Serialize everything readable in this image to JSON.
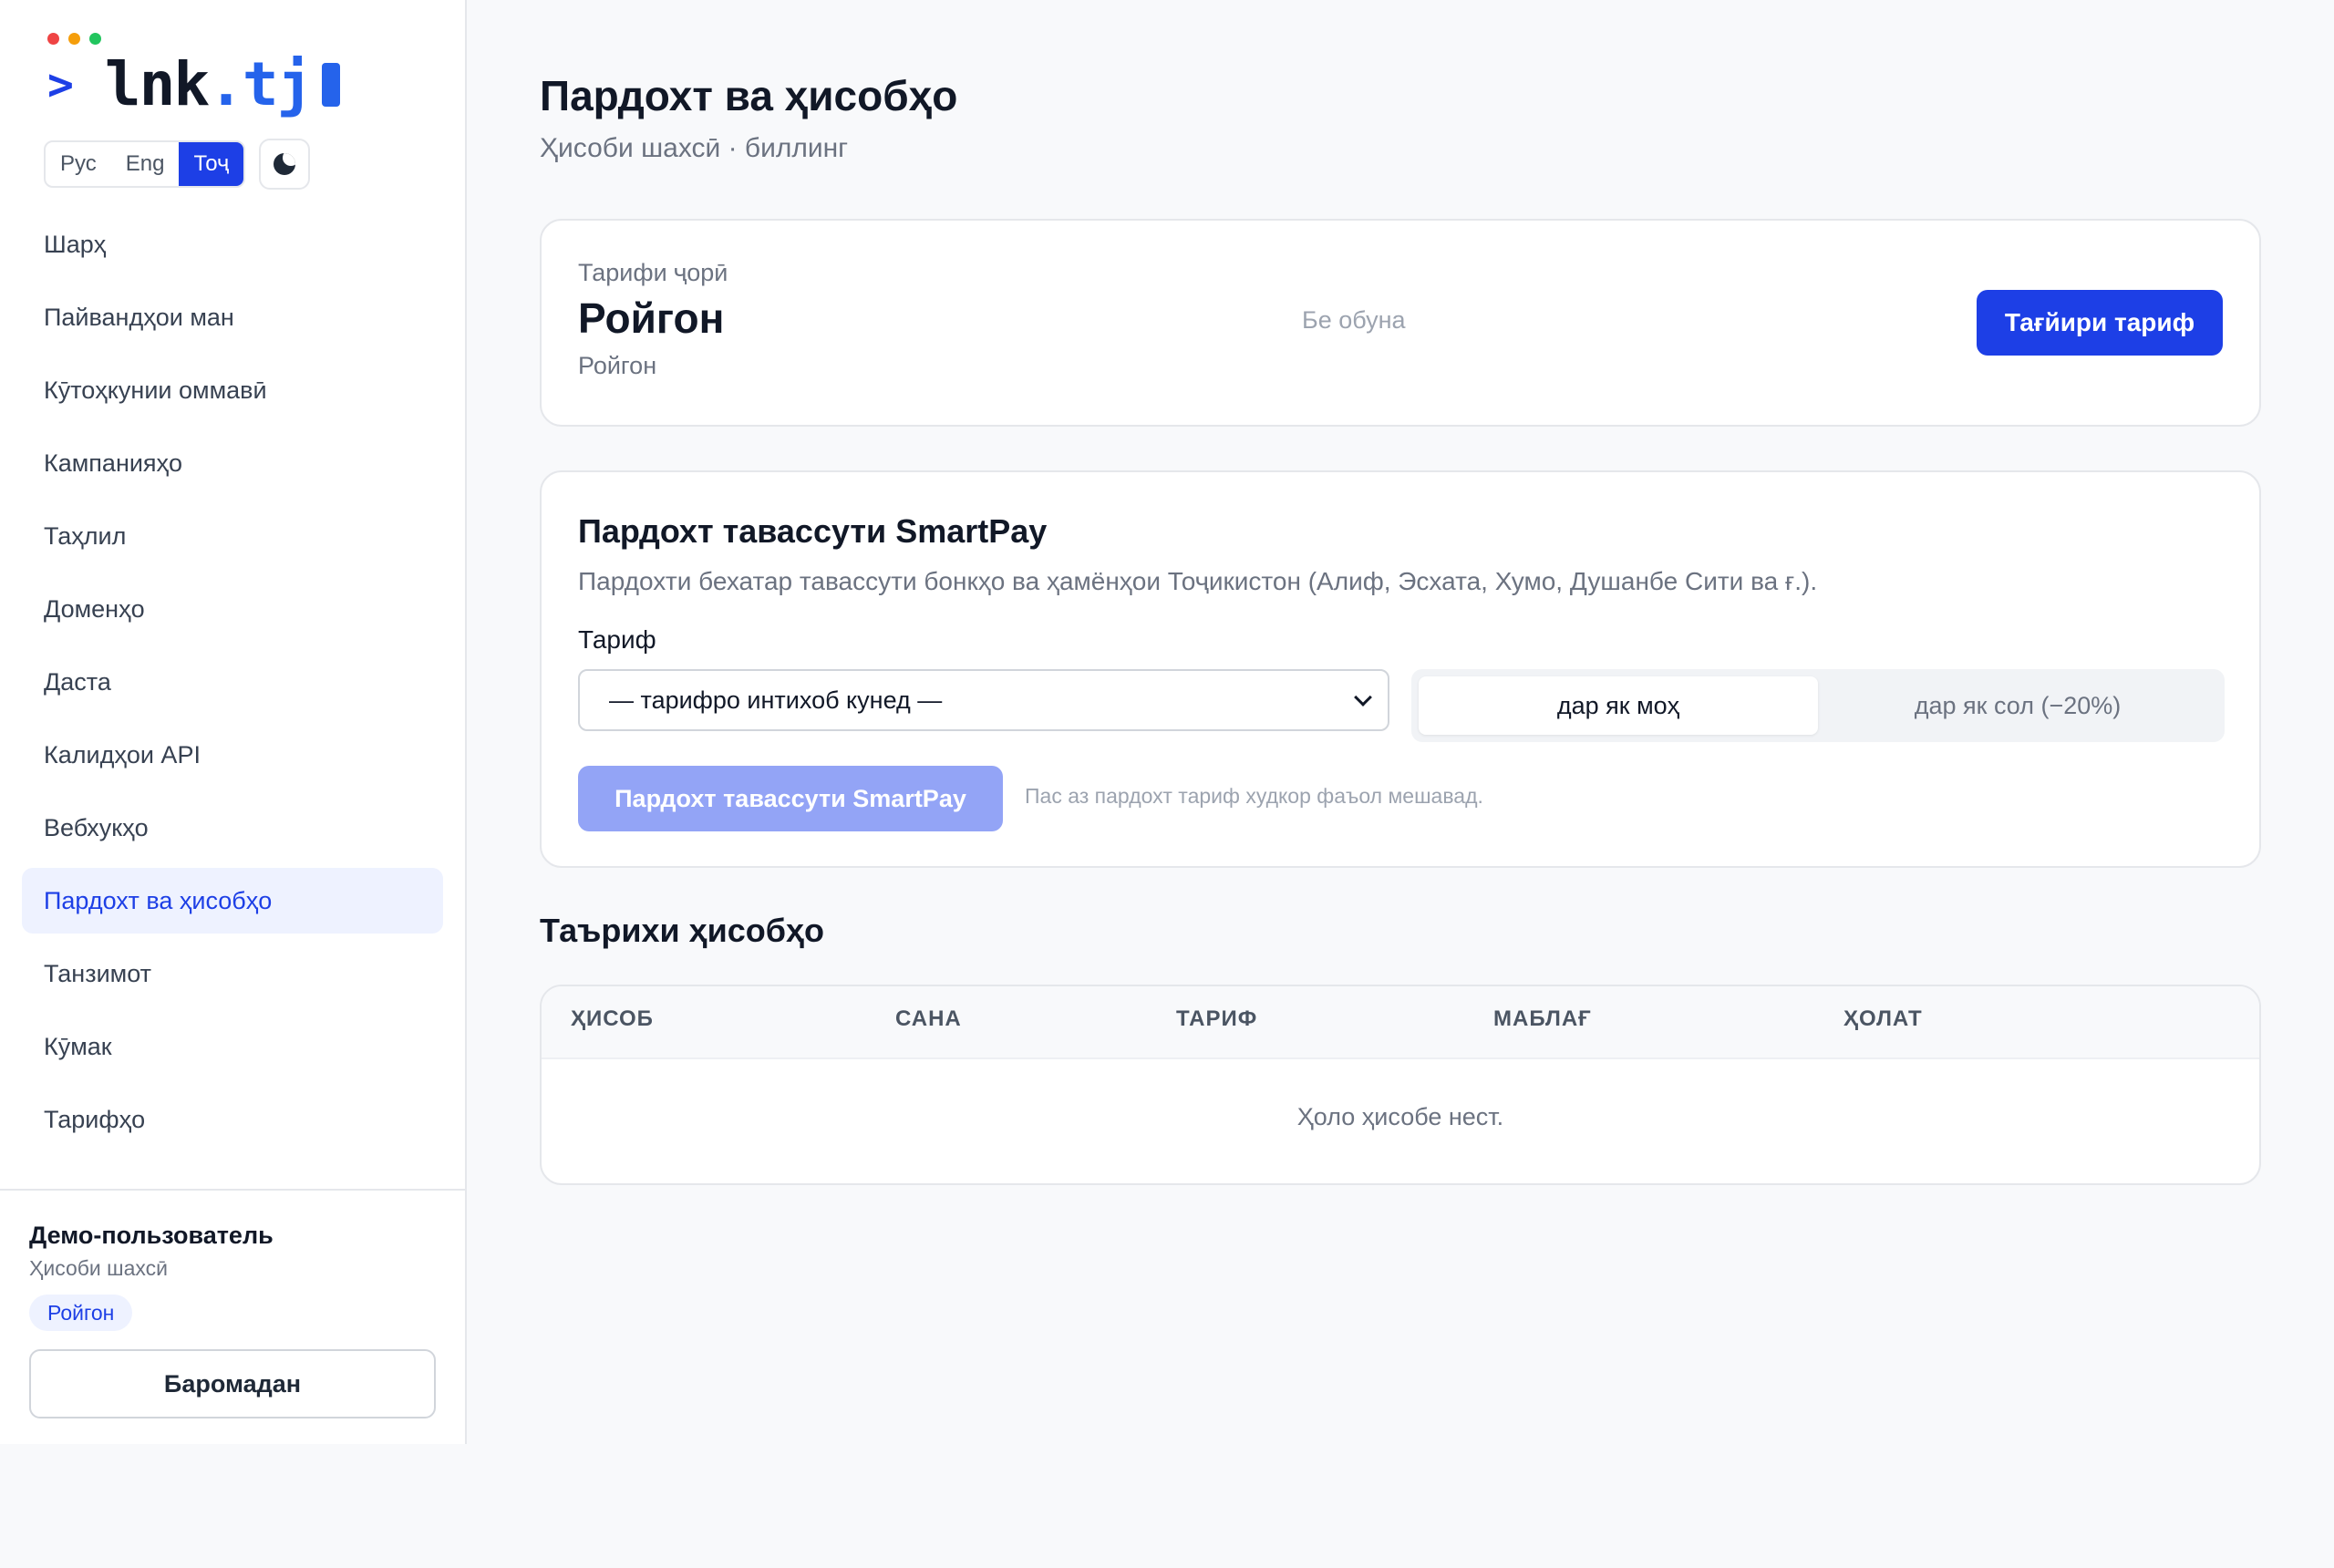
{
  "app": {
    "logo_prompt": ">",
    "logo_name": "lnk",
    "logo_tld": ".tj",
    "window_dots": [
      "#ef4444",
      "#f59e0b",
      "#22c55e"
    ]
  },
  "languages": [
    {
      "label": "Рус",
      "active": false
    },
    {
      "label": "Eng",
      "active": false
    },
    {
      "label": "Тоҷ",
      "active": true
    }
  ],
  "theme_toggle_icon": "moon-icon",
  "nav": [
    {
      "label": "Шарҳ",
      "active": false
    },
    {
      "label": "Пайвандҳои ман",
      "active": false
    },
    {
      "label": "Кӯтоҳкунии оммавӣ",
      "active": false
    },
    {
      "label": "Кампанияҳо",
      "active": false
    },
    {
      "label": "Таҳлил",
      "active": false
    },
    {
      "label": "Доменҳо",
      "active": false
    },
    {
      "label": "Даста",
      "active": false
    },
    {
      "label": "Калидҳои API",
      "active": false
    },
    {
      "label": "Вебхукҳо",
      "active": false
    },
    {
      "label": "Пардохт ва ҳисобҳо",
      "active": true
    },
    {
      "label": "Танзимот",
      "active": false
    },
    {
      "label": "Кӯмак",
      "active": false
    },
    {
      "label": "Тарифҳо",
      "active": false
    }
  ],
  "user": {
    "name": "Демо-пользователь",
    "account": "Ҳисоби шахсӣ",
    "plan": "Ройгон",
    "logout": "Баромадан"
  },
  "page": {
    "title": "Пардохт ва ҳисобҳо",
    "subtitle": "Ҳисоби шахсӣ · биллинг"
  },
  "current_plan": {
    "label": "Тарифи ҷорӣ",
    "name": "Ройгон",
    "sub": "Ройгон",
    "status": "Бе обуна",
    "change_button": "Тағйири тариф"
  },
  "smartpay": {
    "title": "Пардохт тавассути SmartPay",
    "description": "Пардохти бехатар тавассути бонкҳо ва ҳамёнҳои Тоҷикистон (Алиф, Эсхата, Хумо, Душанбе Сити ва ғ.).",
    "field_label": "Тариф",
    "select_value": "— тарифро интихоб кунед —",
    "period_options": [
      {
        "label": "дар як моҳ",
        "active": true
      },
      {
        "label": "дар як сол (−20%)",
        "active": false
      }
    ],
    "pay_button": "Пардохт тавассути SmartPay",
    "hint": "Пас аз пардохт тариф худкор фаъол мешавад."
  },
  "history": {
    "title": "Таърихи ҳисобҳо",
    "columns": [
      "ҲИСОБ",
      "САНА",
      "ТАРИФ",
      "МАБЛАҒ",
      "ҲОЛАТ"
    ],
    "rows": [],
    "empty": "Ҳоло ҳисобе нест."
  },
  "colors": {
    "accent": "#1d3fe6",
    "accent_light": "#eef2ff",
    "disabled_button": "#93a4f6"
  }
}
